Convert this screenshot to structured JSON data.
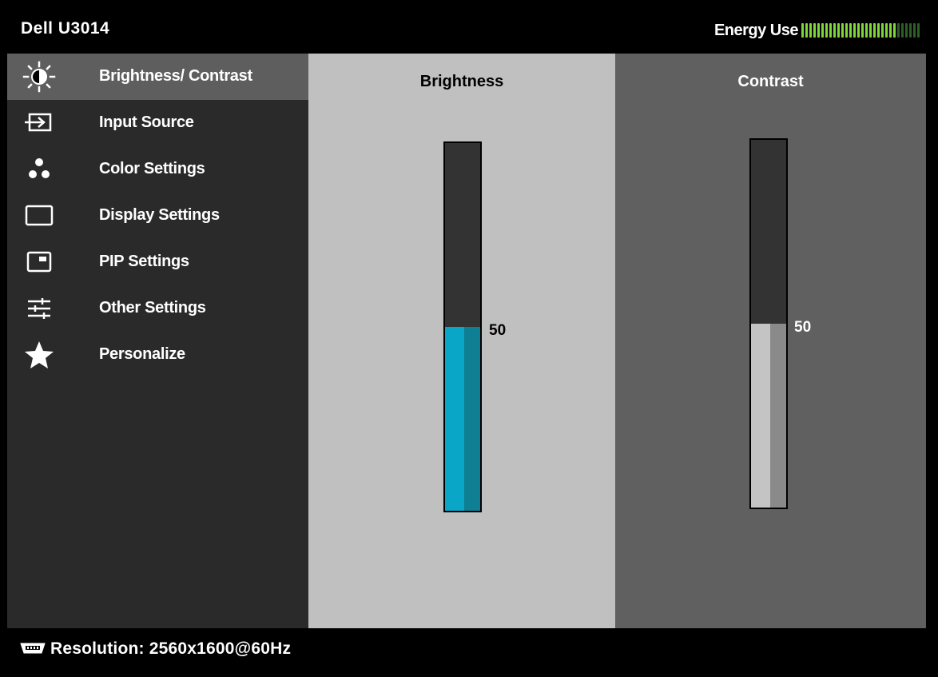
{
  "header": {
    "title": "Dell U3014",
    "energy_label": "Energy Use",
    "energy_level": 0.8,
    "energy_segments": 30
  },
  "menu": {
    "items": [
      {
        "label": "Brightness/ Contrast",
        "icon": "brightness-icon",
        "active": true
      },
      {
        "label": "Input Source",
        "icon": "input-source-icon",
        "active": false
      },
      {
        "label": "Color Settings",
        "icon": "color-settings-icon",
        "active": false
      },
      {
        "label": "Display Settings",
        "icon": "display-settings-icon",
        "active": false
      },
      {
        "label": "PIP Settings",
        "icon": "pip-settings-icon",
        "active": false
      },
      {
        "label": "Other Settings",
        "icon": "other-settings-icon",
        "active": false
      },
      {
        "label": "Personalize",
        "icon": "star-icon",
        "active": false
      }
    ]
  },
  "brightness": {
    "title": "Brightness",
    "value": "50",
    "level": 50,
    "max": 100
  },
  "contrast": {
    "title": "Contrast",
    "value": "50",
    "level": 50,
    "max": 100
  },
  "footer": {
    "resolution": "Resolution: 2560x1600@60Hz",
    "icon": "video-connector-icon"
  },
  "colors": {
    "active_menu_bg": "#5e5e5e",
    "menu_bg": "#2a2a2a",
    "brightness_panel_bg": "#c0c0c0",
    "contrast_panel_bg": "#606060",
    "brightness_fill": "#0aa6c7",
    "brightness_fill_shade": "#0f7f93",
    "contrast_fill": "#c4c4c4",
    "contrast_fill_shade": "#8a8a8a",
    "energy_on": "#7fd63a",
    "energy_off": "#2e5d28"
  }
}
